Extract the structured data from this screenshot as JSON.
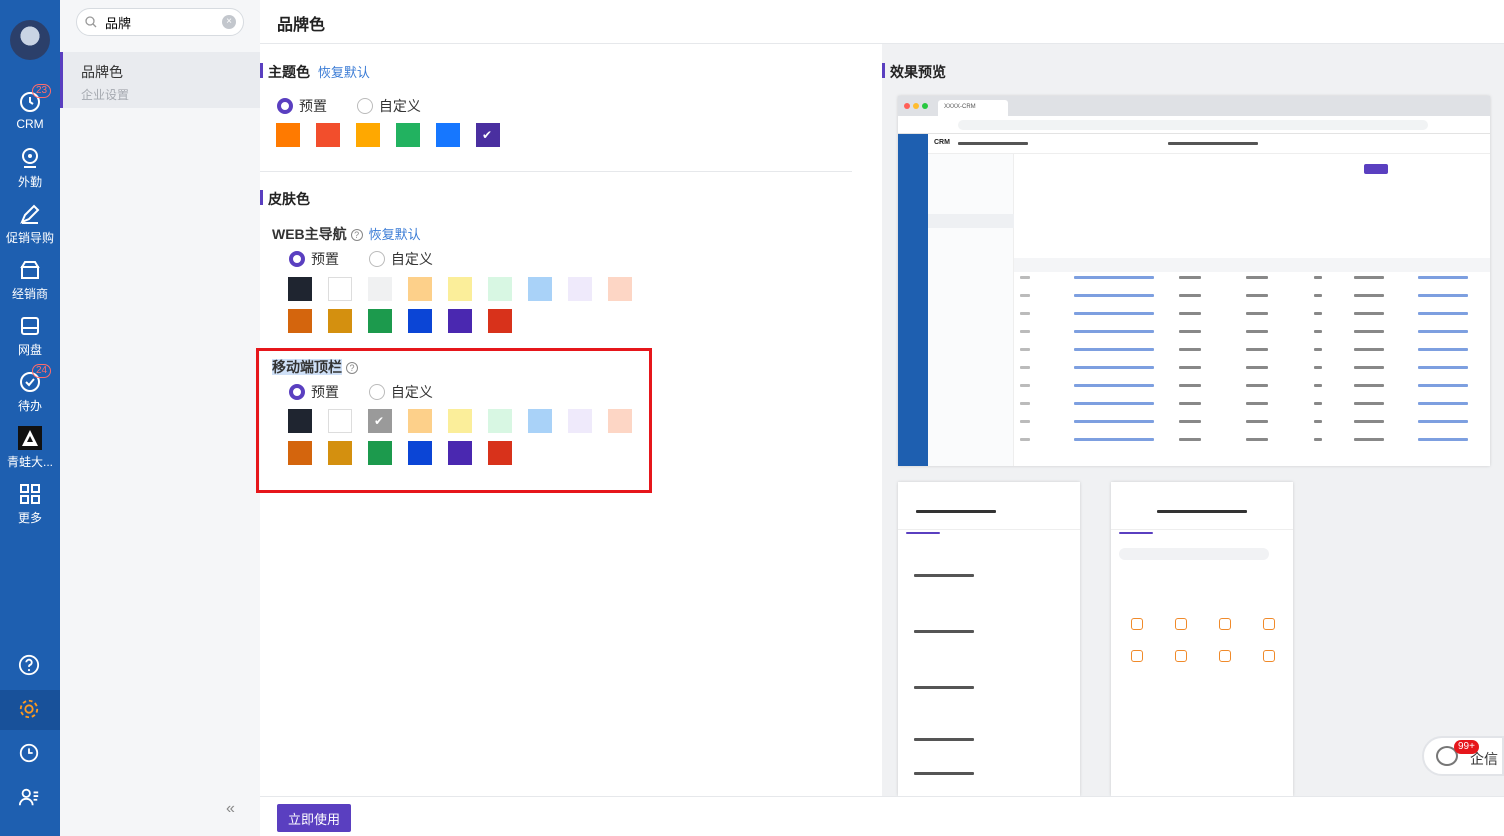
{
  "nav": {
    "items": [
      {
        "label": "CRM",
        "icon": "clock-icon",
        "badge": "23"
      },
      {
        "label": "外勤",
        "icon": "location-pin-icon",
        "badge": ""
      },
      {
        "label": "促销导购",
        "icon": "tag-icon",
        "badge": ""
      },
      {
        "label": "经销商",
        "icon": "store-icon",
        "badge": ""
      },
      {
        "label": "网盘",
        "icon": "disk-icon",
        "badge": ""
      },
      {
        "label": "待办",
        "icon": "check-circle-icon",
        "badge": "24"
      },
      {
        "label": "青蛙大...",
        "icon": "mountain-logo-icon",
        "badge": ""
      },
      {
        "label": "更多",
        "icon": "grid-icon",
        "badge": ""
      }
    ]
  },
  "sidebar": {
    "search_value": "品牌",
    "item_title": "品牌色",
    "item_subtitle": "企业设置"
  },
  "header": {
    "title": "品牌色"
  },
  "theme": {
    "title": "主题色",
    "reset": "恢复默认",
    "preset": "预置",
    "custom": "自定义",
    "swatches": [
      "#ff7a00",
      "#f24e2c",
      "#ffa800",
      "#22b260",
      "#1677ff",
      "#4a2fa0"
    ]
  },
  "skin": {
    "title": "皮肤色",
    "web_nav": {
      "label": "WEB主导航",
      "reset": "恢复默认",
      "preset": "预置",
      "custom": "自定义",
      "row1": [
        "#1f2530",
        "#ffffff",
        "#f0f1f2",
        "#fdd08a",
        "#fbee9a",
        "#d8f7e3",
        "#a9d2f8",
        "#efeafb",
        "#fdd6c5"
      ],
      "row2": [
        "#d4650d",
        "#d4900f",
        "#1c9a4d",
        "#0b45d6",
        "#4a28b0",
        "#d8321b"
      ]
    },
    "mobile_top": {
      "label": "移动端顶栏",
      "preset": "预置",
      "custom": "自定义",
      "row1": [
        "#1f2530",
        "#ffffff",
        "#9a9a9a",
        "#fdd08a",
        "#fbee9a",
        "#d8f7e3",
        "#a9d2f8",
        "#efeafb",
        "#fdd6c5"
      ],
      "row2": [
        "#d4650d",
        "#d4900f",
        "#1c9a4d",
        "#0b45d6",
        "#4a28b0",
        "#d8321b"
      ]
    }
  },
  "preview": {
    "title": "效果预览",
    "browser_tab": "XXXX-CRM",
    "crm_label": "CRM"
  },
  "footer": {
    "apply": "立即使用",
    "collapse": "«"
  },
  "qixin": {
    "badge": "99+",
    "label": "企信"
  },
  "colors": {
    "accent": "#5a3fc0",
    "nav_bg": "#1e5fb0",
    "highlight_border": "#e6161b"
  }
}
